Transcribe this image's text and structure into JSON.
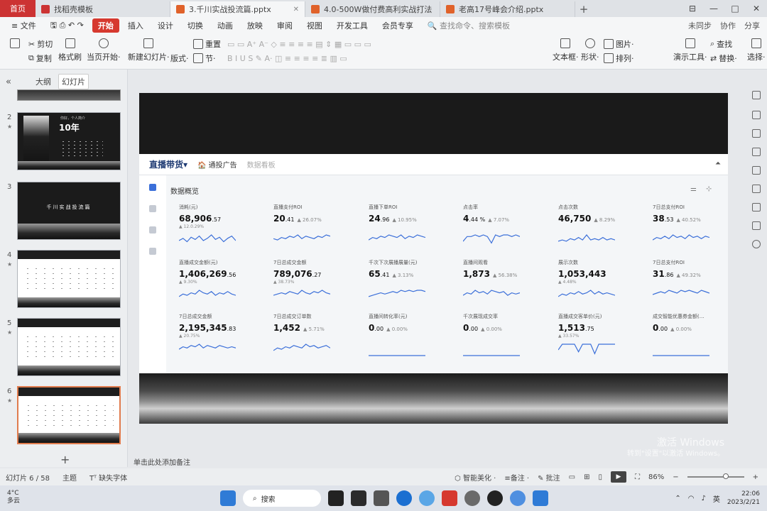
{
  "tabs": {
    "home": "首页",
    "items": [
      {
        "label": "找稻壳模板",
        "color": "#c33",
        "active": false
      },
      {
        "label": "3.千川实战投流篇.pptx",
        "color": "#e0622a",
        "active": true
      },
      {
        "label": "4.0-500W做付费高利实战打法",
        "color": "#e0622a",
        "active": false
      },
      {
        "label": "老高17号峰会介绍.pptx",
        "color": "#e0622a",
        "active": false
      }
    ],
    "new_tab": "+",
    "window_controls": [
      "⊟",
      "—",
      "□",
      "✕"
    ]
  },
  "menu": {
    "file": "≡ 文件",
    "items": [
      "开始",
      "插入",
      "设计",
      "切换",
      "动画",
      "放映",
      "审阅",
      "视图",
      "开发工具",
      "会员专享"
    ],
    "active": "开始",
    "search": "🔍 查找命令、搜索模板",
    "right": [
      "未同步",
      "协作",
      "分享"
    ]
  },
  "ribbon": {
    "cut": "剪切",
    "copy": "复制",
    "format_painter": "格式刷",
    "from_current": "当页开始·",
    "new_slide": "新建幻灯片·",
    "layout": "版式·",
    "reset": "重置",
    "section": "节·",
    "textbox": "文本框·",
    "shape": "形状·",
    "image": "图片·",
    "arrange": "排列·",
    "presentation_tool": "演示工具·",
    "find": "查找",
    "replace": "替换·",
    "select": "选择·"
  },
  "left_panel": {
    "outline": "大纲",
    "slides": "幻灯片",
    "thumbs": [
      {
        "num": "2",
        "type": "person",
        "title_small": "你好，个人简介",
        "title_big": "10年"
      },
      {
        "num": "3",
        "type": "title",
        "text": "千川实战投流篇"
      },
      {
        "num": "4",
        "type": "table"
      },
      {
        "num": "5",
        "type": "table"
      },
      {
        "num": "6",
        "type": "table",
        "selected": true
      }
    ],
    "add": "+"
  },
  "slide": {
    "brand": "直播带货▾",
    "ad_label": "🏠 通投广告",
    "ad_sub": "数据看板",
    "section_title": "数据概览",
    "metrics": [
      {
        "label": "消耗(元)",
        "value": "68,906",
        "dec": ".57",
        "change": "▲ 12.0.29%",
        "spark": [
          5,
          7,
          4,
          8,
          6,
          9,
          5,
          7,
          10,
          6,
          8,
          4,
          7,
          9,
          5
        ]
      },
      {
        "label": "直播支付ROI",
        "value": "20",
        "dec": ".41",
        "sub": "▲ 26.07%",
        "change": "",
        "spark": [
          6,
          5,
          7,
          6,
          8,
          7,
          9,
          6,
          8,
          7,
          6,
          8,
          7,
          9,
          8
        ]
      },
      {
        "label": "直播下单ROI",
        "value": "24",
        "dec": ".96",
        "sub": "▲ 10.95%",
        "change": "",
        "spark": [
          5,
          7,
          6,
          8,
          7,
          9,
          8,
          7,
          9,
          6,
          8,
          7,
          9,
          8,
          7
        ]
      },
      {
        "label": "点击率",
        "value": "4",
        "dec": ".44 %",
        "sub": "▲ 7.07%",
        "change": "",
        "spark": [
          3,
          6,
          6,
          7,
          6,
          7,
          6,
          2,
          7,
          6,
          7,
          7,
          6,
          7,
          6
        ]
      },
      {
        "label": "点击次数",
        "value": "46,750",
        "dec": "",
        "sub": "▲ 8.29%",
        "change": "",
        "spark": [
          4,
          5,
          4,
          6,
          5,
          7,
          5,
          9,
          5,
          6,
          5,
          7,
          5,
          6,
          5
        ]
      },
      {
        "label": "7日总支付ROI",
        "value": "38",
        "dec": ".53",
        "sub": "▲ 40.52%",
        "change": "",
        "spark": [
          5,
          7,
          6,
          8,
          6,
          9,
          7,
          8,
          6,
          9,
          7,
          8,
          6,
          8,
          7
        ]
      },
      {
        "label": "直播成交金额(元)",
        "value": "1,406,269",
        "dec": ".56",
        "change": "▲ 9.30%",
        "spark": [
          4,
          6,
          5,
          7,
          6,
          9,
          7,
          6,
          8,
          5,
          7,
          6,
          8,
          6,
          5
        ]
      },
      {
        "label": "7日总成交金额",
        "value": "789,076",
        "dec": ".27",
        "change": "▲ 38.73%",
        "spark": [
          5,
          6,
          7,
          6,
          8,
          7,
          6,
          9,
          7,
          6,
          8,
          7,
          9,
          7,
          6
        ]
      },
      {
        "label": "千次下次展播展量(元)",
        "value": "65",
        "dec": ".41",
        "sub": "▲ 3.13%",
        "change": "",
        "spark": [
          4,
          5,
          6,
          7,
          6,
          7,
          8,
          7,
          9,
          8,
          9,
          8,
          9,
          9,
          8
        ]
      },
      {
        "label": "直播间观看",
        "value": "1,873",
        "dec": "",
        "sub": "▲ 56.38%",
        "change": "",
        "spark": [
          5,
          7,
          6,
          9,
          7,
          8,
          6,
          9,
          8,
          7,
          8,
          5,
          7,
          6,
          7
        ]
      },
      {
        "label": "展示次数",
        "value": "1,053,443",
        "dec": "",
        "change": "▲ 4.48%",
        "spark": [
          4,
          6,
          5,
          7,
          6,
          8,
          6,
          7,
          9,
          6,
          8,
          6,
          7,
          6,
          5
        ]
      },
      {
        "label": "7日总支付ROI",
        "value": "31",
        "dec": ".86",
        "sub": "▲ 49.32%",
        "change": "",
        "spark": [
          5,
          6,
          7,
          6,
          8,
          7,
          6,
          8,
          7,
          8,
          7,
          6,
          8,
          7,
          6
        ]
      },
      {
        "label": "7日总成交金额",
        "value": "2,195,345",
        "dec": ".83",
        "change": "▲ 20.75%",
        "spark": [
          5,
          7,
          6,
          8,
          7,
          9,
          6,
          8,
          7,
          6,
          8,
          7,
          6,
          7,
          6
        ]
      },
      {
        "label": "7日总成交订单数",
        "value": "1,452",
        "dec": "",
        "sub": "▲ 5.71%",
        "change": "",
        "spark": [
          4,
          6,
          5,
          7,
          6,
          8,
          7,
          6,
          9,
          7,
          8,
          6,
          7,
          8,
          6
        ]
      },
      {
        "label": "直播间转化率(元)",
        "value": "0",
        "dec": ".00",
        "sub": "▲ 0.00%",
        "change": "",
        "spark": [
          0,
          0,
          0,
          0,
          0,
          0,
          0,
          0,
          0,
          0,
          0,
          0,
          0,
          0,
          0
        ]
      },
      {
        "label": "千次展现成交率",
        "value": "0",
        "dec": ".00",
        "sub": "▲ 0.00%",
        "change": "",
        "spark": [
          0,
          0,
          0,
          0,
          0,
          0,
          0,
          0,
          0,
          0,
          0,
          0,
          0,
          0,
          0
        ]
      },
      {
        "label": "直播成交客单价(元)",
        "value": "1,513",
        "dec": ".75",
        "change": "▲ 33.57%",
        "spark": [
          3,
          6,
          6,
          6,
          6,
          2,
          6,
          6,
          6,
          1,
          6,
          6,
          6,
          6,
          6
        ]
      },
      {
        "label": "成交智能优惠券金额(…",
        "value": "0",
        "dec": ".00",
        "sub": "▲ 0.00%",
        "change": "",
        "spark": [
          0,
          0,
          0,
          0,
          0,
          0,
          0,
          0,
          0,
          0,
          0,
          0,
          0,
          0,
          0
        ]
      }
    ]
  },
  "notes": "单击此处添加备注",
  "status": {
    "slide": "幻灯片 6 / 58",
    "theme": "主题",
    "font": "缺失字体",
    "beautify": "智能美化 ·",
    "notes": "≡备注 ·",
    "comment": "批注",
    "zoom": "86%"
  },
  "watermark": {
    "line1": "激活 Windows",
    "line2": "转到\"设置\"以激活 Windows。"
  },
  "taskbar": {
    "temp": "4°C",
    "weather": "多云",
    "search": "搜索",
    "ime": "英",
    "time": "22:06",
    "date": "2023/2/21",
    "apps": [
      "#2f7bd6",
      "#222",
      "#2b2b2b",
      "#444",
      "#555",
      "#5aa6e6",
      "#1b6fd1",
      "#d6392f",
      "#6a6a6a",
      "#222",
      "#4f8fe0",
      "#2f7bd6"
    ]
  }
}
